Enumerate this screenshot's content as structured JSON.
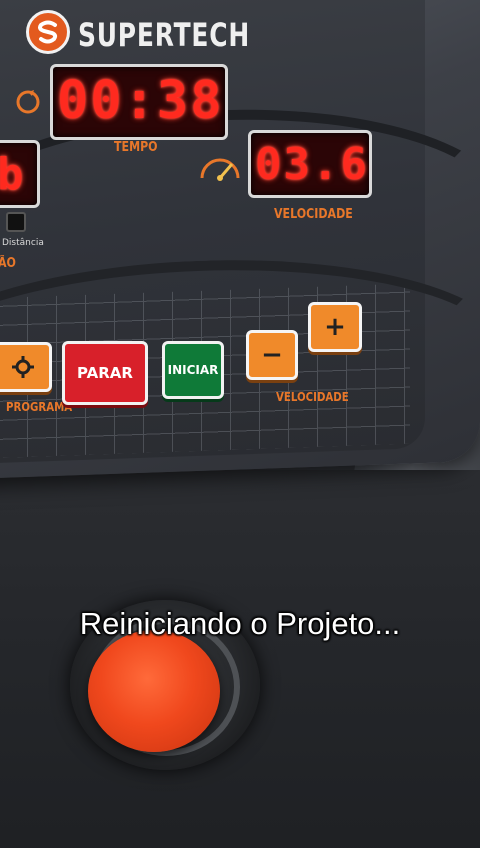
{
  "console": {
    "brand": "SUPERTECH",
    "time_display": "00:38",
    "time_label": "TEMPO",
    "speed_display": "03.6",
    "speed_label": "VELOCIDADE",
    "left_display_partial": "b",
    "distance_label": "Distância",
    "left_label_partial": "ÃO",
    "buttons": {
      "stop": "PARAR",
      "start": "INICIAR",
      "speed_down": "−",
      "speed_up": "+",
      "program_label": "PROGRAMA",
      "speed_buttons_label": "VELOCIDADE"
    }
  },
  "caption": "Reiniciando o Projeto...",
  "colors": {
    "led_red": "#ff2a1f",
    "label_orange": "#e8772a",
    "logo_orange": "#e35a1e",
    "stop_red": "#d8202a",
    "start_green": "#0f7a38",
    "emergency_orange": "#f0481d"
  }
}
